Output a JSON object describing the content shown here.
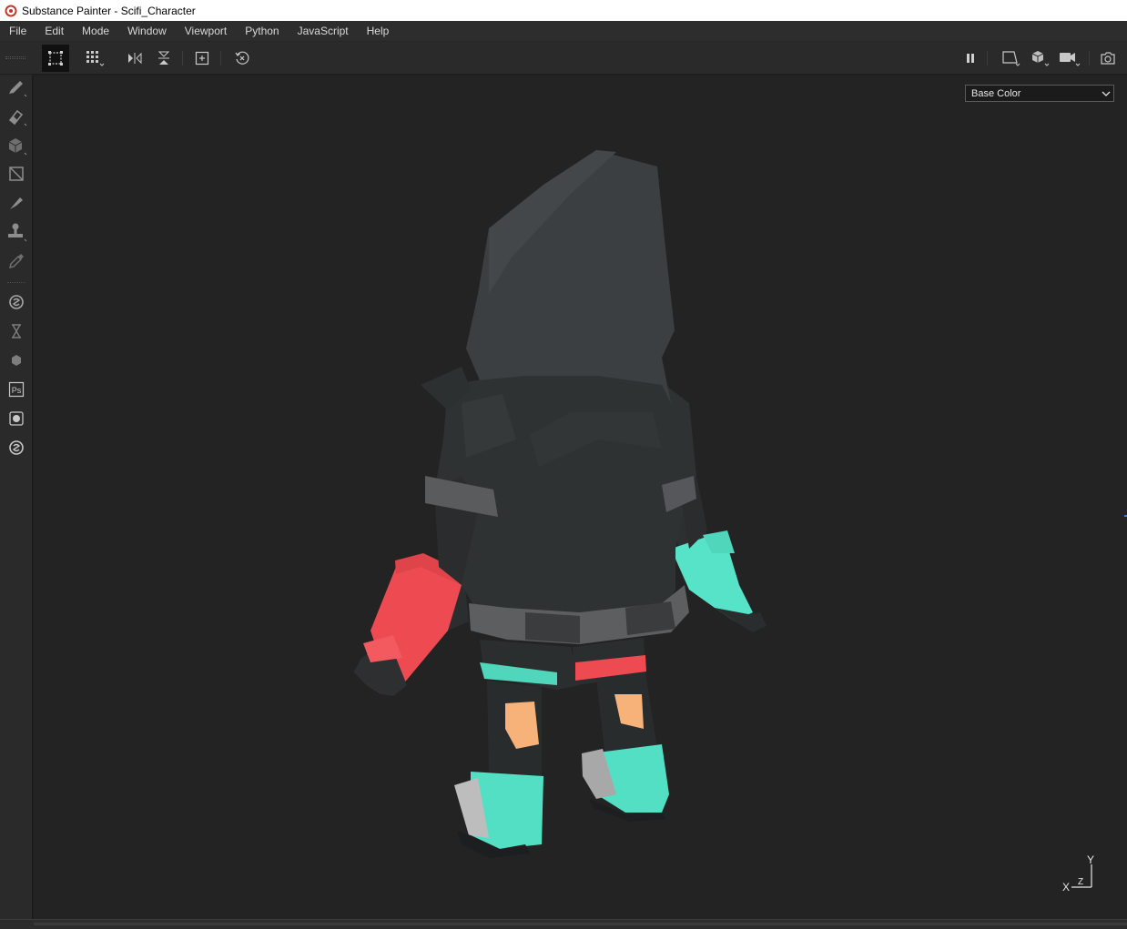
{
  "window": {
    "title": "Substance Painter - Scifi_Character",
    "app_icon": "substance-painter-logo"
  },
  "menu": {
    "items": [
      "File",
      "Edit",
      "Mode",
      "Window",
      "Viewport",
      "Python",
      "JavaScript",
      "Help"
    ]
  },
  "toolbar": {
    "left_icons": [
      "select-mode-icon",
      "grid-mode-icon",
      "mirror-x-icon",
      "mirror-y-icon",
      "add-frame-icon",
      "reset-camera-icon"
    ],
    "right_icons": [
      "pause-icon",
      "view-2d-icon",
      "view-3d-cube-icon",
      "camera-icon",
      "screenshot-icon"
    ]
  },
  "tools": {
    "icons": [
      "paint-brush-icon",
      "eraser-icon",
      "projection-icon",
      "polygon-fill-icon",
      "smudge-icon",
      "clone-stamp-icon",
      "color-picker-icon",
      "substance-source-icon",
      "bake-icon",
      "substance-3d-icon",
      "photoshop-icon",
      "material-ball-icon",
      "settings-icon"
    ]
  },
  "viewport": {
    "channel": {
      "selected": "Base Color"
    },
    "axes": {
      "x": "X",
      "y": "Y",
      "z": "Z"
    }
  },
  "colors": {
    "accent_teal": "#52e0c4",
    "accent_red": "#f04d53",
    "skin": "#f7b27a",
    "cloth_dark": "#2f3233"
  }
}
